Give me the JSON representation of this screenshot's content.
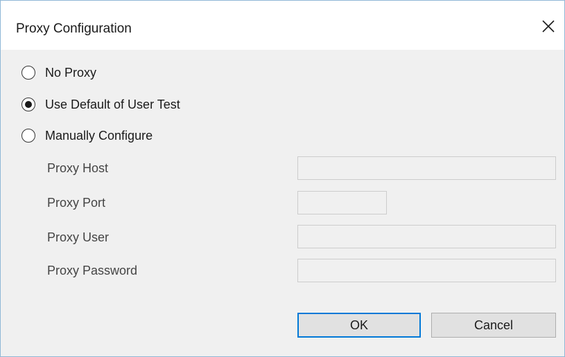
{
  "window": {
    "title": "Proxy Configuration"
  },
  "proxy_mode": {
    "options": [
      {
        "label": "No Proxy",
        "selected": false
      },
      {
        "label": "Use Default of User Test",
        "selected": true
      },
      {
        "label": "Manually Configure",
        "selected": false
      }
    ]
  },
  "manual": {
    "host_label": "Proxy Host",
    "host_value": "",
    "port_label": "Proxy Port",
    "port_value": "",
    "user_label": "Proxy User",
    "user_value": "",
    "password_label": "Proxy Password",
    "password_value": ""
  },
  "buttons": {
    "ok_label": "OK",
    "cancel_label": "Cancel"
  },
  "colors": {
    "accent": "#0078d7",
    "window_border": "#8fb7d6",
    "dialog_bg": "#f0f0f0"
  }
}
